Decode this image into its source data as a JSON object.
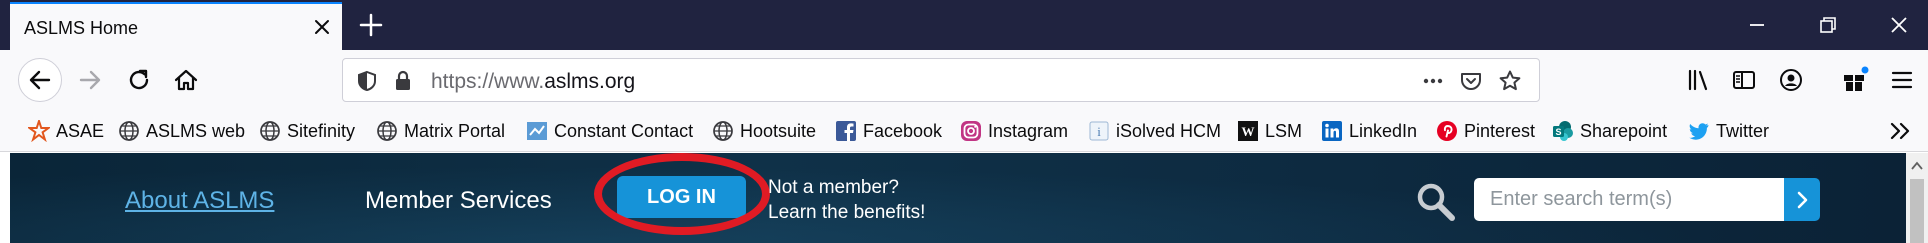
{
  "tab": {
    "title": "ASLMS Home"
  },
  "url": {
    "prefix": "https://www.",
    "domain": "aslms.org"
  },
  "bookmarks": [
    {
      "label": "ASAE",
      "icon": "asae-icon"
    },
    {
      "label": "ASLMS web",
      "icon": "globe-icon"
    },
    {
      "label": "Sitefinity",
      "icon": "globe-icon"
    },
    {
      "label": "Matrix Portal",
      "icon": "globe-icon"
    },
    {
      "label": "Constant Contact",
      "icon": "constant-contact-icon"
    },
    {
      "label": "Hootsuite",
      "icon": "globe-icon"
    },
    {
      "label": "Facebook",
      "icon": "facebook-icon"
    },
    {
      "label": "Instagram",
      "icon": "instagram-icon"
    },
    {
      "label": "iSolved HCM",
      "icon": "isolved-icon"
    },
    {
      "label": "LSM",
      "icon": "lsm-icon"
    },
    {
      "label": "LinkedIn",
      "icon": "linkedin-icon"
    },
    {
      "label": "Pinterest",
      "icon": "pinterest-icon"
    },
    {
      "label": "Sharepoint",
      "icon": "sharepoint-icon"
    },
    {
      "label": "Twitter",
      "icon": "twitter-icon"
    }
  ],
  "site": {
    "about_link": "About ASLMS",
    "member_services": "Member Services",
    "login_label": "LOG IN",
    "not_member_line1": "Not a member?",
    "not_member_line2": "Learn the benefits!",
    "search_placeholder": "Enter search term(s)"
  },
  "colors": {
    "tabstrip_bg": "#202340",
    "tab_accent": "#0a84ff",
    "page_bg": "#0f3148",
    "link": "#5eb3e6",
    "button_blue": "#1693d8",
    "highlight_circle": "#e01b24"
  }
}
